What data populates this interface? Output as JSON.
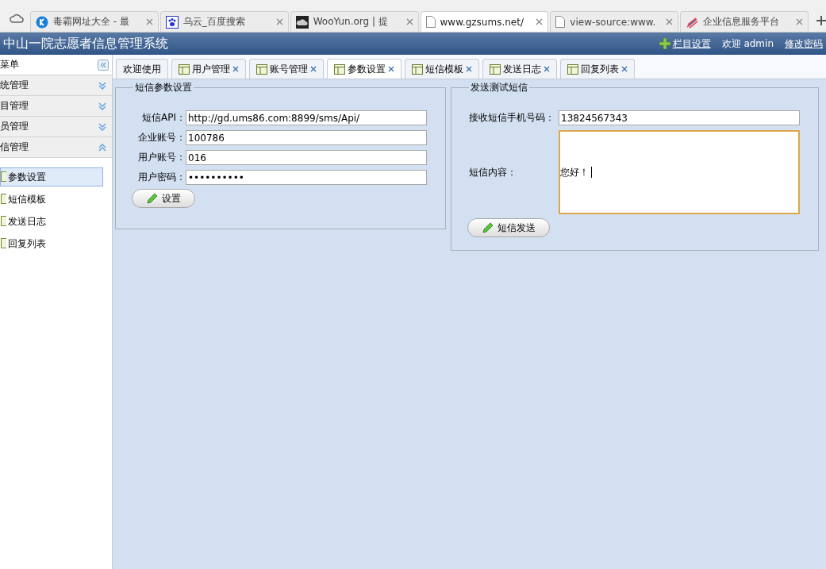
{
  "browser_tabs": [
    {
      "title": "毒霸网址大全 - 最",
      "kind": "k",
      "selected": false
    },
    {
      "title": "乌云_百度搜索",
      "kind": "paw",
      "selected": false
    },
    {
      "title": "WooYun.org | 提",
      "kind": "cloud",
      "selected": false
    },
    {
      "title": "www.gzsums.net/",
      "kind": "page",
      "selected": true
    },
    {
      "title": "view-source:www.",
      "kind": "page",
      "selected": false
    },
    {
      "title": "企业信息服务平台",
      "kind": "stripes",
      "selected": false
    }
  ],
  "header": {
    "title": "中山一院志愿者信息管理系统",
    "column_settings": "栏目设置",
    "welcome": "欢迎 admin",
    "change_password": "修改密码"
  },
  "sidebar": {
    "title": "菜单",
    "groups": [
      {
        "label": "统管理",
        "expanded": false
      },
      {
        "label": "目管理",
        "expanded": false
      },
      {
        "label": "员管理",
        "expanded": false
      },
      {
        "label": "信管理",
        "expanded": true,
        "children": [
          {
            "label": "参数设置",
            "selected": true
          },
          {
            "label": "短信模板",
            "selected": false
          },
          {
            "label": "发送日志",
            "selected": false
          },
          {
            "label": "回复列表",
            "selected": false
          }
        ]
      }
    ]
  },
  "tabs": [
    {
      "label": "欢迎使用",
      "closable": false,
      "selected": false
    },
    {
      "label": "用户管理",
      "closable": true,
      "selected": false
    },
    {
      "label": "账号管理",
      "closable": true,
      "selected": false
    },
    {
      "label": "参数设置",
      "closable": true,
      "selected": true
    },
    {
      "label": "短信模板",
      "closable": true,
      "selected": false
    },
    {
      "label": "发送日志",
      "closable": true,
      "selected": false
    },
    {
      "label": "回复列表",
      "closable": true,
      "selected": false
    }
  ],
  "sms_settings": {
    "legend": "短信参数设置",
    "fields": [
      {
        "label": "短信API：",
        "value": "http://gd.ums86.com:8899/sms/Api/"
      },
      {
        "label": "企业账号：",
        "value": "100786"
      },
      {
        "label": "用户账号：",
        "value": "016"
      },
      {
        "label": "用户密码：",
        "value": "••••••••••"
      }
    ],
    "button": "设置"
  },
  "test_sms": {
    "legend": "发送测试短信",
    "phone_label": "接收短信手机号码：",
    "phone": "13824567343",
    "content_label": "短信内容：",
    "content": "您好！",
    "button": "短信发送"
  }
}
